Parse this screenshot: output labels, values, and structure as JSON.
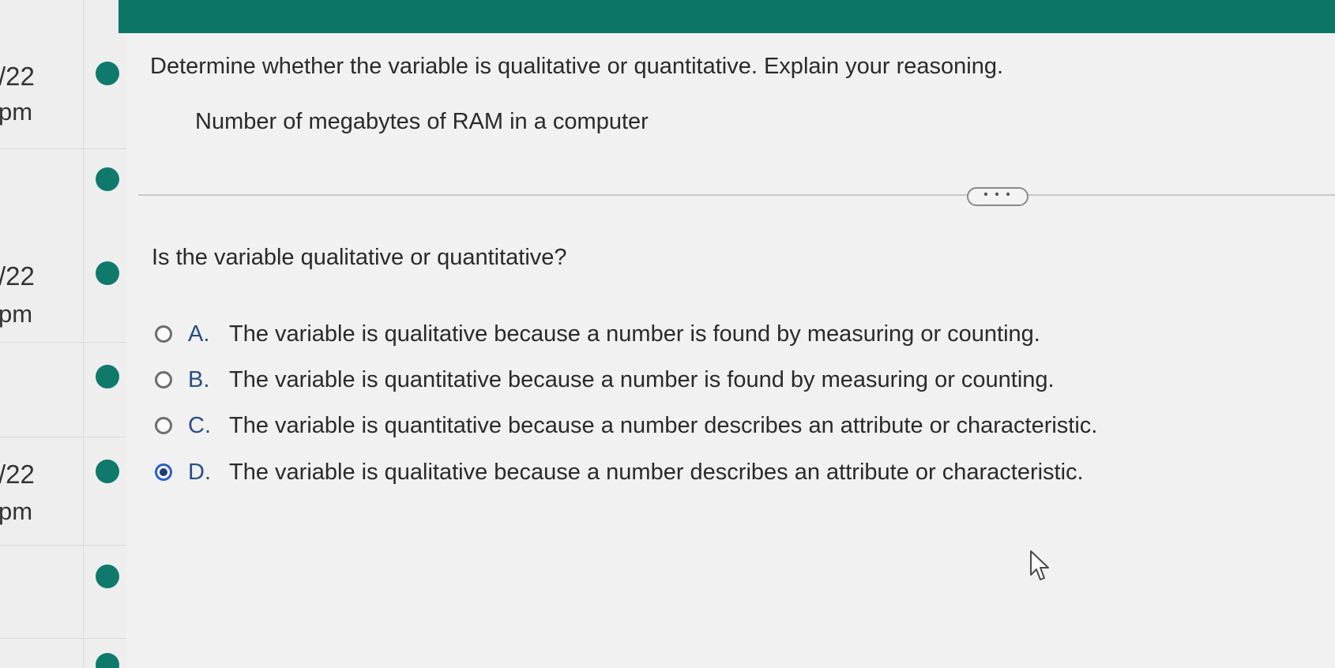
{
  "sidebar": {
    "entries": [
      {
        "date": "/22",
        "time": "pm"
      },
      {
        "date": "/22",
        "time": "pm"
      },
      {
        "date": "/22",
        "time": "pm"
      }
    ],
    "accent_color": "#0f7a6c"
  },
  "header": {
    "bar_color": "#0d7565"
  },
  "problem": {
    "instruction": "Determine whether the variable is qualitative or quantitative. Explain your reasoning.",
    "variable": "Number of megabytes of RAM in a computer",
    "expand_label": "• • •",
    "question": "Is the variable qualitative or quantitative?",
    "options": [
      {
        "letter": "A.",
        "text": "The variable is qualitative because a number is found by measuring or counting.",
        "selected": false
      },
      {
        "letter": "B.",
        "text": "The variable is quantitative because a number is found by measuring or counting.",
        "selected": false
      },
      {
        "letter": "C.",
        "text": "The variable is quantitative because a number describes an attribute or characteristic.",
        "selected": false
      },
      {
        "letter": "D.",
        "text": "The variable is qualitative because a number describes an attribute or characteristic.",
        "selected": true
      }
    ]
  },
  "icons": {
    "cursor": "mouse-pointer-icon",
    "status": "status-dot-icon"
  }
}
